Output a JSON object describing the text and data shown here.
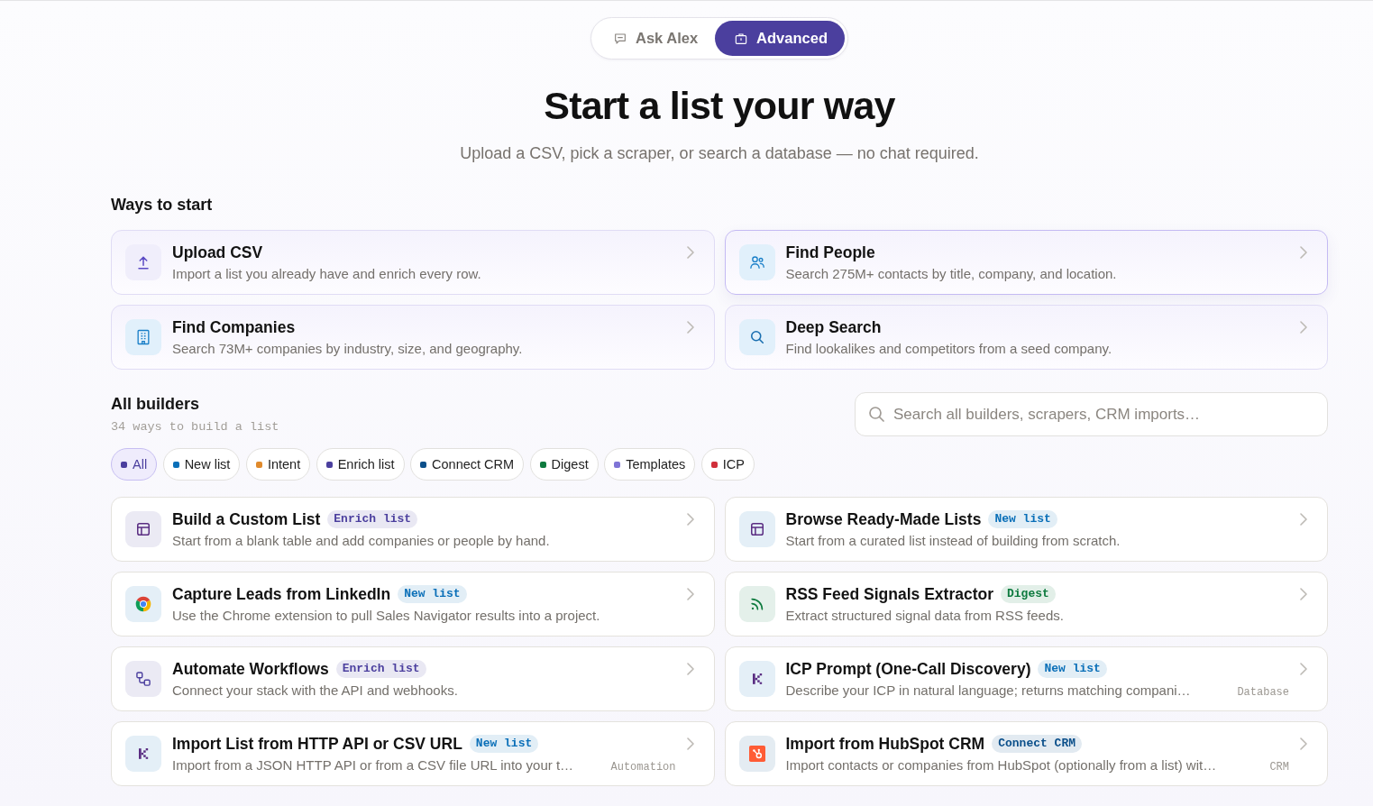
{
  "mode_toggle": [
    {
      "label": "Ask Alex",
      "selected": false
    },
    {
      "label": "Advanced",
      "selected": true
    }
  ],
  "header": {
    "title": "Start a list your way",
    "subtitle": "Upload a CSV, pick a scraper, or search a database — no chat required."
  },
  "ways_to_start": {
    "heading": "Ways to start",
    "cards": [
      {
        "kind": "upload",
        "title": "Upload CSV",
        "description": "Import a list you already have and enrich every row.",
        "highlighted": false
      },
      {
        "kind": "people",
        "title": "Find People",
        "description": "Search 275M+ contacts by title, company, and location.",
        "highlighted": true
      },
      {
        "kind": "building",
        "title": "Find Companies",
        "description": "Search 73M+ companies by industry, size, and geography.",
        "highlighted": false
      },
      {
        "kind": "search",
        "title": "Deep Search",
        "description": "Find lookalikes and competitors from a seed company.",
        "highlighted": false
      }
    ]
  },
  "all_builders": {
    "heading": "All builders",
    "count": "34 ways to build a list",
    "search": {
      "placeholder": "Search all builders, scrapers, CRM imports…"
    },
    "filters": [
      {
        "label": "All",
        "color": "#4b3f9e",
        "selected": true
      },
      {
        "label": "New list",
        "color": "#0a6fb8",
        "selected": false
      },
      {
        "label": "Intent",
        "color": "#e08a2c",
        "selected": false
      },
      {
        "label": "Enrich list",
        "color": "#4b3f9e",
        "selected": false
      },
      {
        "label": "Connect CRM",
        "color": "#0b4f8a",
        "selected": false
      },
      {
        "label": "Digest",
        "color": "#0d7a3e",
        "selected": false
      },
      {
        "label": "Templates",
        "color": "#7f74d6",
        "selected": false
      },
      {
        "label": "ICP",
        "color": "#d02f3a",
        "selected": false
      }
    ],
    "builders": [
      {
        "kind": "table",
        "title": "Build a Custom List",
        "tag": {
          "label": "Enrich list",
          "color": "#4b3f9e"
        },
        "description": "Start from a blank table and add companies or people by hand."
      },
      {
        "kind": "table",
        "title": "Browse Ready-Made Lists",
        "tag": {
          "label": "New list",
          "color": "#0a6fb8"
        },
        "description": "Start from a curated list instead of building from scratch."
      },
      {
        "kind": "wheel",
        "title": "Capture Leads from LinkedIn",
        "tag": {
          "label": "New list",
          "color": "#0a6fb8"
        },
        "description": "Use the Chrome extension to pull Sales Navigator results into a project."
      },
      {
        "kind": "rss",
        "title": "RSS Feed Signals Extractor",
        "tag": {
          "label": "Digest",
          "color": "#0d7a3e"
        },
        "description": "Extract structured signal data from RSS feeds."
      },
      {
        "kind": "workflow",
        "title": "Automate Workflows",
        "tag": {
          "label": "Enrich list",
          "color": "#4b3f9e"
        },
        "description": "Connect your stack with the API and webhooks."
      },
      {
        "kind": "k-logo",
        "title": "ICP Prompt (One-Call Discovery)",
        "tag": {
          "label": "New list",
          "color": "#0a6fb8"
        },
        "description": "Describe your ICP in natural language; returns matching compani…",
        "source": "Database"
      },
      {
        "kind": "k-logo",
        "title": "Import List from HTTP API or CSV URL",
        "tag": {
          "label": "New list",
          "color": "#0a6fb8"
        },
        "description": "Import from a JSON HTTP API or from a CSV file URL into your t…",
        "source": "Automation"
      },
      {
        "kind": "hubspot",
        "title": "Import from HubSpot CRM",
        "tag": {
          "label": "Connect CRM",
          "color": "#0b4f8a"
        },
        "description": "Import contacts or companies from HubSpot (optionally from a list) wit…",
        "source": "CRM"
      }
    ]
  }
}
